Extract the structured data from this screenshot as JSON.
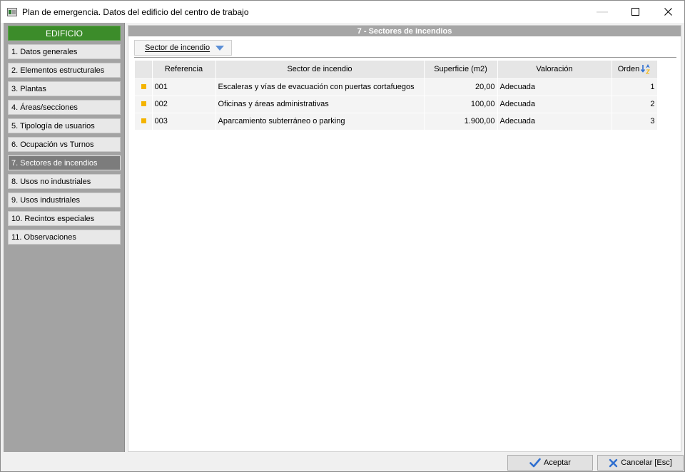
{
  "window": {
    "title": "Plan de emergencia. Datos del edificio del centro de trabajo",
    "controls": {
      "minimize": "—",
      "maximize": "☐",
      "close": "✕"
    }
  },
  "sidebar": {
    "header": "EDIFICIO",
    "items": [
      {
        "label": "1. Datos generales"
      },
      {
        "label": "2. Elementos estructurales"
      },
      {
        "label": "3. Plantas"
      },
      {
        "label": "4. Áreas/secciones"
      },
      {
        "label": "5. Tipología de usuarios"
      },
      {
        "label": "6. Ocupación vs Turnos"
      },
      {
        "label": "7. Sectores de incendios"
      },
      {
        "label": "8. Usos no industriales"
      },
      {
        "label": "9. Usos industriales"
      },
      {
        "label": "10. Recintos especiales"
      },
      {
        "label": "11. Observaciones"
      }
    ],
    "active_index": 6
  },
  "main": {
    "section_title": "7 - Sectores de incendios",
    "toolbar": {
      "dropdown_label": "Sector de incendio"
    },
    "table": {
      "columns": [
        "Referencia",
        "Sector de incendio",
        "Superficie (m2)",
        "Valoración",
        "Orden"
      ],
      "rows": [
        {
          "referencia": "001",
          "sector": "Escaleras y vías de evacuación con puertas cortafuegos",
          "superficie": "20,00",
          "valoracion": "Adecuada",
          "orden": "1"
        },
        {
          "referencia": "002",
          "sector": "Oficinas y áreas administrativas",
          "superficie": "100,00",
          "valoracion": "Adecuada",
          "orden": "2"
        },
        {
          "referencia": "003",
          "sector": "Aparcamiento subterráneo o parking",
          "superficie": "1.900,00",
          "valoracion": "Adecuada",
          "orden": "3"
        }
      ]
    }
  },
  "footer": {
    "accept_label": "Aceptar",
    "cancel_label": "Cancelar [Esc]"
  },
  "colors": {
    "header_green": "#3c8c2a",
    "row_indicator": "#f4b400",
    "check_blue": "#2f6fd0",
    "sort_blue": "#2f6fd0"
  },
  "icons": {
    "accept": "check-icon",
    "cancel": "x-icon",
    "sort": "sort-ascending-icon",
    "dropdown": "chevron-down-icon",
    "app": "app-window-icon"
  }
}
